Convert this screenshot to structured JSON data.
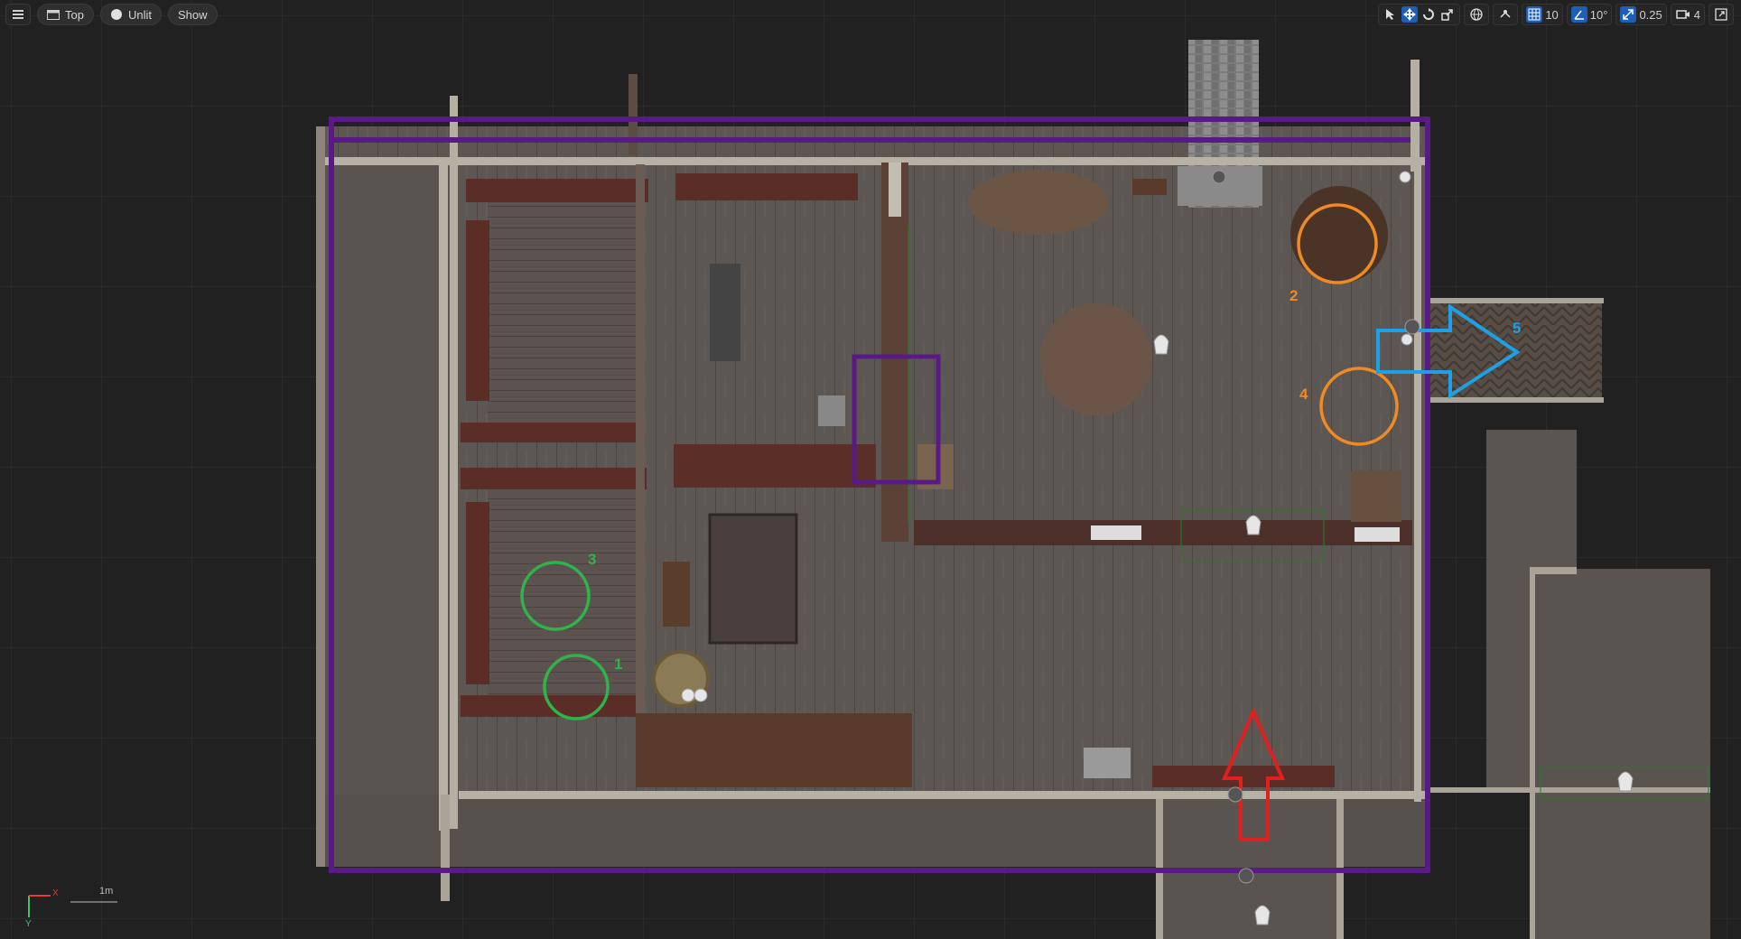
{
  "toolbar": {
    "menu_icon": "hamburger-icon",
    "view_mode": "Top",
    "lighting_mode": "Unlit",
    "show_label": "Show",
    "grid_snap": "10",
    "rotation_snap": "10°",
    "scale_snap": "0.25",
    "camera_speed": "4"
  },
  "viewport": {
    "scale_label": "1m",
    "axis_labels": {
      "x": "X",
      "y": "Y"
    }
  },
  "markers": {
    "green": [
      {
        "label": "1"
      },
      {
        "label": "3"
      }
    ],
    "orange": [
      {
        "label": "2"
      },
      {
        "label": "4"
      }
    ],
    "blue_arrow": {
      "label": "5"
    }
  },
  "colors": {
    "purple": "#5a1a86",
    "green": "#2fb34a",
    "orange": "#f08a24",
    "blue": "#1ea0e6",
    "red": "#e21f1f",
    "floor": "#5c5652",
    "wall_light": "#b8b2a6",
    "wood_dark": "#4a2a22"
  }
}
